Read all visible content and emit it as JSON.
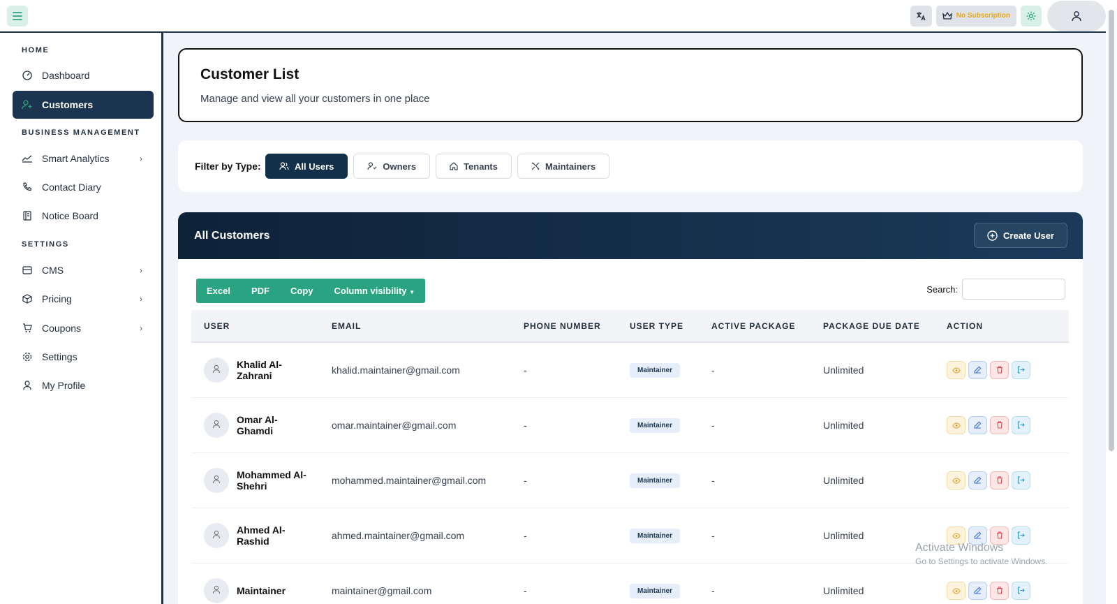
{
  "topbar": {
    "subscription_label": "No Subscription",
    "colors": {
      "accent": "#1b3550",
      "green": "#2aa380",
      "gold": "#f0a500"
    }
  },
  "sidebar": {
    "sections": [
      "HOME",
      "BUSINESS MANAGEMENT",
      "SETTINGS"
    ],
    "items": [
      {
        "label": "Dashboard",
        "icon": "dashboard-icon"
      },
      {
        "label": "Customers",
        "icon": "user-plus-icon",
        "active": true
      },
      {
        "label": "Smart Analytics",
        "icon": "chart-line-icon",
        "has_submenu": true
      },
      {
        "label": "Contact Diary",
        "icon": "phone-icon"
      },
      {
        "label": "Notice Board",
        "icon": "notice-board-icon"
      },
      {
        "label": "CMS",
        "icon": "cms-icon",
        "has_submenu": true
      },
      {
        "label": "Pricing",
        "icon": "box-icon",
        "has_submenu": true
      },
      {
        "label": "Coupons",
        "icon": "cart-icon",
        "has_submenu": true
      },
      {
        "label": "Settings",
        "icon": "gear-icon"
      },
      {
        "label": "My Profile",
        "icon": "user-icon"
      }
    ]
  },
  "header_card": {
    "title": "Customer List",
    "subtitle": "Manage and view all your customers in one place"
  },
  "filter": {
    "label": "Filter by Type:",
    "options": [
      "All Users",
      "Owners",
      "Tenants",
      "Maintainers"
    ],
    "selected": "All Users"
  },
  "table_card": {
    "title": "All Customers",
    "create_label": "Create User",
    "export_buttons": [
      "Excel",
      "PDF",
      "Copy",
      "Column visibility"
    ],
    "search_label": "Search:",
    "columns": [
      "USER",
      "EMAIL",
      "PHONE NUMBER",
      "USER TYPE",
      "ACTIVE PACKAGE",
      "PACKAGE DUE DATE",
      "ACTION"
    ],
    "rows": [
      {
        "name": "Khalid Al-Zahrani",
        "email": "khalid.maintainer@gmail.com",
        "phone": "-",
        "type": "Maintainer",
        "package": "-",
        "due": "Unlimited"
      },
      {
        "name": "Omar Al-Ghamdi",
        "email": "omar.maintainer@gmail.com",
        "phone": "-",
        "type": "Maintainer",
        "package": "-",
        "due": "Unlimited"
      },
      {
        "name": "Mohammed Al-Shehri",
        "email": "mohammed.maintainer@gmail.com",
        "phone": "-",
        "type": "Maintainer",
        "package": "-",
        "due": "Unlimited"
      },
      {
        "name": "Ahmed Al-Rashid",
        "email": "ahmed.maintainer@gmail.com",
        "phone": "-",
        "type": "Maintainer",
        "package": "-",
        "due": "Unlimited"
      },
      {
        "name": "Maintainer",
        "email": "maintainer@gmail.com",
        "phone": "-",
        "type": "Maintainer",
        "package": "-",
        "due": "Unlimited"
      }
    ]
  },
  "watermark": {
    "line1": "Activate Windows",
    "line2": "Go to Settings to activate Windows."
  }
}
